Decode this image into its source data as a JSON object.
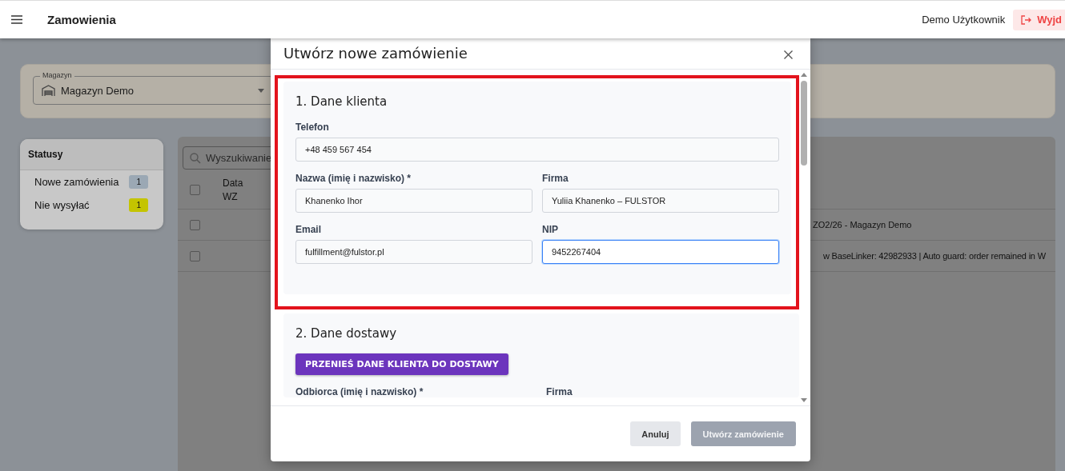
{
  "app_bar": {
    "title": "Zamowienia",
    "user": "Demo Użytkownik",
    "logout": "Wyjd"
  },
  "warehouse": {
    "label": "Magazyn",
    "value": "Magazyn Demo"
  },
  "statuses": {
    "title": "Statusy",
    "items": [
      {
        "label": "Nowe zamówienia",
        "count": "1",
        "color": "#9ba8b4"
      },
      {
        "label": "Nie wysyłać",
        "count": "1",
        "color": "#c4c400"
      }
    ]
  },
  "orders": {
    "search_placeholder": "Wyszukiwanie",
    "header_checked": false,
    "column_header": "Data WZ",
    "rows": [
      {
        "checked": false,
        "text": "ZO2/26 - Magazyn Demo"
      },
      {
        "checked": false,
        "text": "w BaseLinker: 42982933 | Auto guard: order remained in W"
      }
    ]
  },
  "modal": {
    "title": "Utwórz nowe zamówienie",
    "highlighted": true,
    "client": {
      "title": "1. Dane klienta",
      "fields": [
        {
          "label": "Telefon",
          "value": "+48 459 567 454",
          "focused": false
        },
        {
          "label": "Nazwa (imię i nazwisko) *",
          "value": "Khanenko Ihor",
          "focused": false
        },
        {
          "label": "Firma",
          "value": "Yuliia Khanenko – FULSTOR",
          "focused": false
        },
        {
          "label": "Email",
          "value": "fulfillment@fulstor.pl",
          "focused": false
        },
        {
          "label": "NIP",
          "value": "9452267404",
          "focused": true
        }
      ]
    },
    "delivery": {
      "title": "2. Dane dostawy",
      "copy_button": "PRZENIEŚ DANE KLIENTA DO DOSTAWY",
      "labels": [
        "Odbiorca (imię i nazwisko) *",
        "Firma"
      ]
    },
    "cancel": "Anuluj",
    "submit": {
      "label": "Utwórz zamówienie",
      "disabled": true
    }
  }
}
